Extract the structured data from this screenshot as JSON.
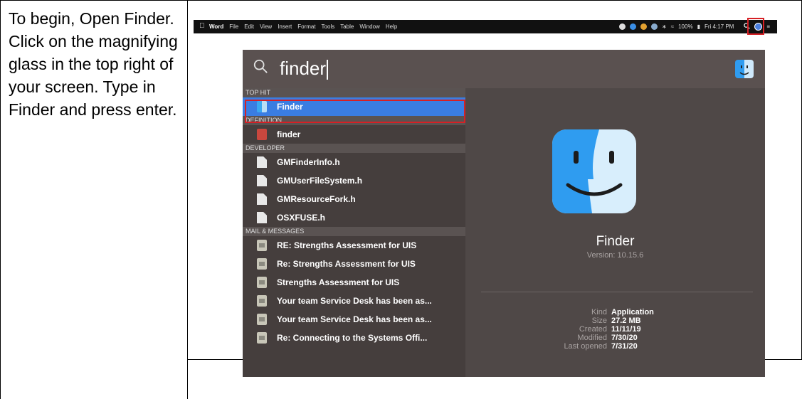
{
  "instruction": "To begin, Open Finder. Click on the magnifying glass in the top right of your screen. Type in Finder and press enter.",
  "menubar": {
    "app": "Word",
    "menus": [
      "File",
      "Edit",
      "View",
      "Insert",
      "Format",
      "Tools",
      "Table",
      "Window",
      "Help"
    ],
    "battery": "100%",
    "clock": "Fri 4:17 PM"
  },
  "spotlight": {
    "query": "finder",
    "sections": [
      {
        "header": "TOP HIT",
        "items": [
          {
            "label": "Finder",
            "icon": "finder-icon",
            "selected": true
          }
        ]
      },
      {
        "header": "DEFINITION",
        "items": [
          {
            "label": "finder",
            "icon": "dictionary-icon"
          }
        ]
      },
      {
        "header": "DEVELOPER",
        "items": [
          {
            "label": "GMFinderInfo.h",
            "icon": "document-icon"
          },
          {
            "label": "GMUserFileSystem.h",
            "icon": "document-icon"
          },
          {
            "label": "GMResourceFork.h",
            "icon": "document-icon"
          },
          {
            "label": "OSXFUSE.h",
            "icon": "document-icon"
          }
        ]
      },
      {
        "header": "MAIL & MESSAGES",
        "items": [
          {
            "label": "RE: Strengths Assessment for UIS",
            "icon": "mail-icon"
          },
          {
            "label": "Re: Strengths Assessment for UIS",
            "icon": "mail-icon"
          },
          {
            "label": "Strengths Assessment for UIS",
            "icon": "mail-icon"
          },
          {
            "label": "Your team Service Desk has been as...",
            "icon": "mail-icon"
          },
          {
            "label": "Your team Service Desk has been as...",
            "icon": "mail-icon"
          },
          {
            "label": "Re: Connecting to the Systems Offi...",
            "icon": "mail-icon"
          }
        ]
      }
    ],
    "preview": {
      "name": "Finder",
      "version": "Version: 10.15.6",
      "meta": [
        {
          "key": "Kind",
          "value": "Application"
        },
        {
          "key": "Size",
          "value": "27.2 MB"
        },
        {
          "key": "Created",
          "value": "11/11/19"
        },
        {
          "key": "Modified",
          "value": "7/30/20"
        },
        {
          "key": "Last opened",
          "value": "7/31/20"
        }
      ]
    }
  },
  "colors": {
    "highlight": "#d62025",
    "selection": "#3a7de2"
  }
}
